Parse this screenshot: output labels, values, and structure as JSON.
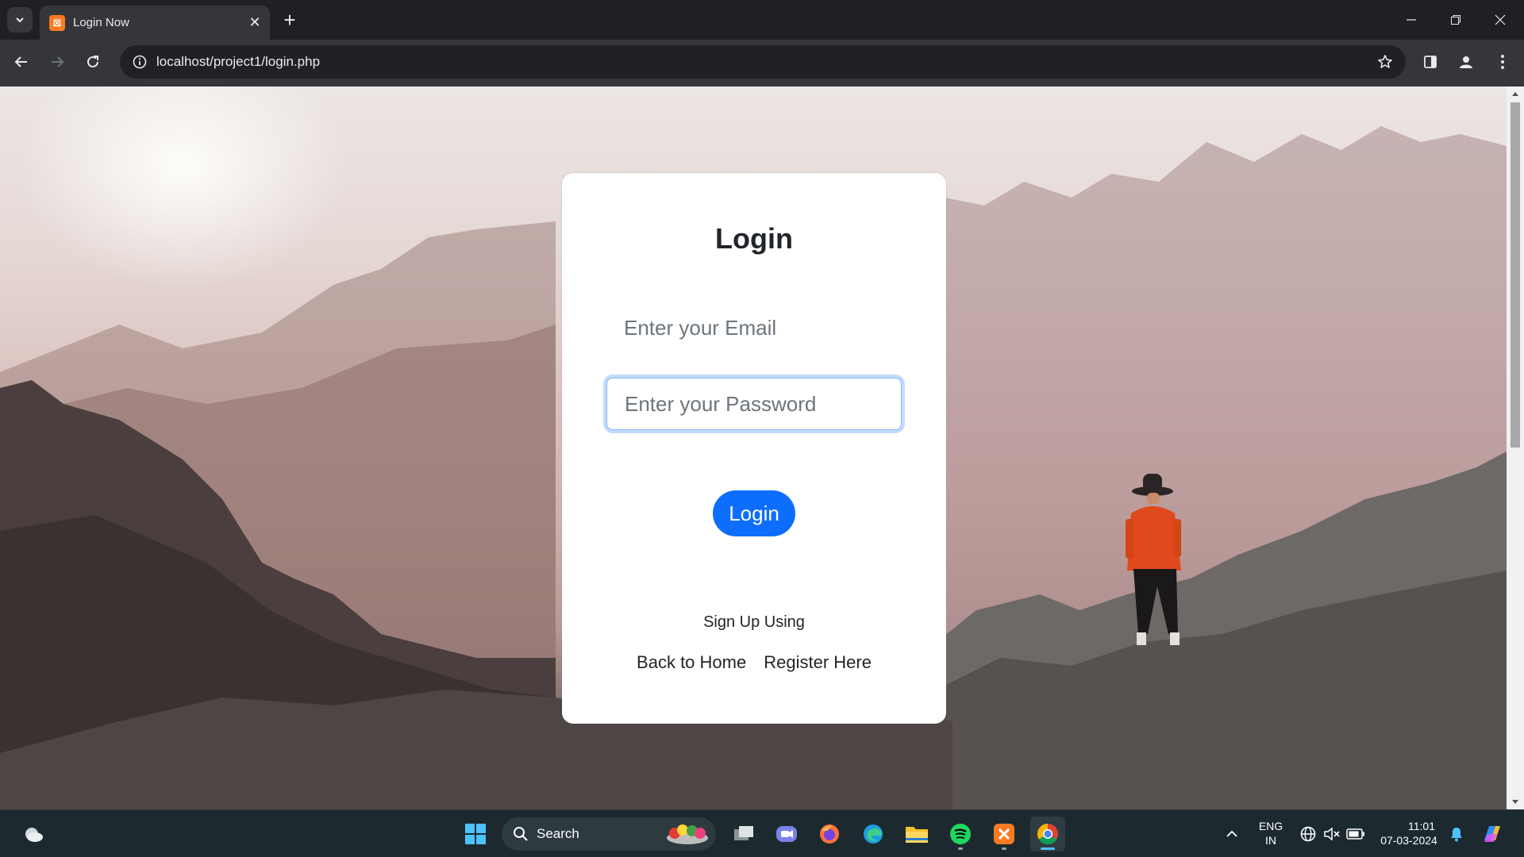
{
  "browser": {
    "tab_title": "Login Now",
    "url": "localhost/project1/login.php"
  },
  "page": {
    "title": "Login",
    "email_placeholder": "Enter your Email",
    "password_placeholder": "Enter your Password",
    "login_button": "Login",
    "signup_text": "Sign Up Using",
    "back_home_link": "Back to Home",
    "register_link": "Register Here"
  },
  "taskbar": {
    "search_label": "Search",
    "language_top": "ENG",
    "language_bottom": "IN",
    "time": "11:01",
    "date": "07-03-2024"
  },
  "colors": {
    "primary_button": "#0d6efd",
    "focus_ring": "#86b7fe",
    "taskbar_bg": "#1c2a30"
  }
}
